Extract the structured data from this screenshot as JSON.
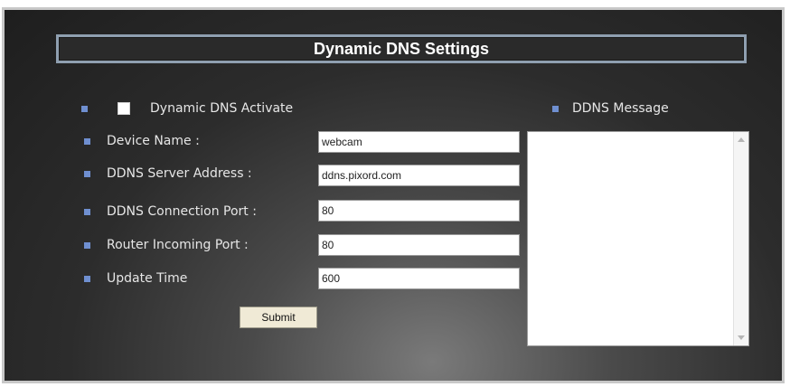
{
  "page": {
    "title": "Dynamic DNS Settings"
  },
  "form": {
    "activate_label": "Dynamic DNS Activate",
    "activate_checked": false,
    "device_name": {
      "label": "Device Name :",
      "value": "webcam"
    },
    "server_address": {
      "label": "DDNS Server Address :",
      "value": "ddns.pixord.com"
    },
    "connection_port": {
      "label": "DDNS Connection Port :",
      "value": "80"
    },
    "router_port": {
      "label": "Router Incoming Port :",
      "value": "80"
    },
    "update_time": {
      "label": "Update Time",
      "value": "600"
    },
    "submit_label": "Submit"
  },
  "message": {
    "label": "DDNS Message",
    "text": ""
  },
  "colors": {
    "bullet": "#6f8fd0",
    "title_border": "#8f9fb0",
    "submit_bg": "#f0ead6"
  }
}
